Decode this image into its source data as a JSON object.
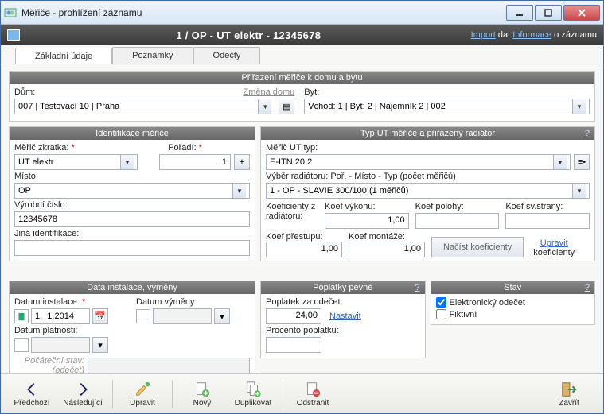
{
  "window": {
    "title": "Měřiče - prohlížení záznamu"
  },
  "subheader": {
    "path": "1 / OP - UT elektr - 12345678",
    "import": "Import",
    "dat": " dat ",
    "informace": "Informace",
    "ozaznamu": " o záznamu"
  },
  "tabs": {
    "t1": "Základní údaje",
    "t2": "Poznámky",
    "t3": "Odečty"
  },
  "assign": {
    "title": "Přiřazení měřiče k domu a bytu",
    "house_label": "Dům:",
    "house_value": "007 | Testovací 10 | Praha",
    "change_house": "Změna domu",
    "flat_label": "Byt:",
    "flat_value": "Vchod: 1 | Byt:  2 | Nájemník 2 |  002"
  },
  "ident": {
    "title": "Identifikace měřiče",
    "shortcut_label": "Měřič zkratka:",
    "shortcut_value": "UT elektr",
    "order_label": "Pořadí:",
    "order_value": "1",
    "place_label": "Místo:",
    "place_value": "OP",
    "serial_label": "Výrobní číslo:",
    "serial_value": "12345678",
    "otherid_label": "Jiná identifikace:",
    "otherid_value": ""
  },
  "uttype": {
    "title": "Typ UT měřiče a přiřazený radiátor",
    "type_label": "Měřič UT typ:",
    "type_value": "E-ITN 20.2",
    "rad_label": "Výběr radiátoru:  Poř. - Místo - Typ (počet měřičů)",
    "rad_value": "1 - OP - SLAVIE 300/100 (1 měřičů)",
    "coef_from": "Koeficienty z radiátoru:",
    "k_power_l": "Koef výkonu:",
    "k_power_v": "1,00",
    "k_pos_l": "Koef polohy:",
    "k_pos_v": "",
    "k_side_l": "Koef sv.strany:",
    "k_side_v": "",
    "k_trans_l": "Koef přestupu:",
    "k_trans_v": "1,00",
    "k_mount_l": "Koef montáže:",
    "k_mount_v": "1,00",
    "load_btn": "Načíst koeficienty",
    "edit_link": "Upravit",
    "edit_suffix": "koeficienty"
  },
  "dates": {
    "title": "Data instalace, výměny",
    "install_l": "Datum instalace:",
    "install_v": "1.  1.2014",
    "exchange_l": "Datum výměny:",
    "validity_l": "Datum platnosti:",
    "initstate_l1": "Počáteční stav:",
    "initstate_l2": "(odečet)"
  },
  "fees": {
    "title": "Poplatky pevné",
    "fee_label": "Poplatek za odečet:",
    "fee_value": "24,00",
    "set_link": "Nastavit",
    "pct_label": "Procento poplatku:",
    "pct_value": ""
  },
  "state": {
    "title": "Stav",
    "electronic": "Elektronický odečet",
    "fictive": "Fiktivní"
  },
  "toolbar": {
    "prev": "Předchozí",
    "next": "Následující",
    "edit": "Upravit",
    "new": "Nový",
    "dup": "Duplikovat",
    "del": "Odstranit",
    "close": "Zavřít"
  }
}
